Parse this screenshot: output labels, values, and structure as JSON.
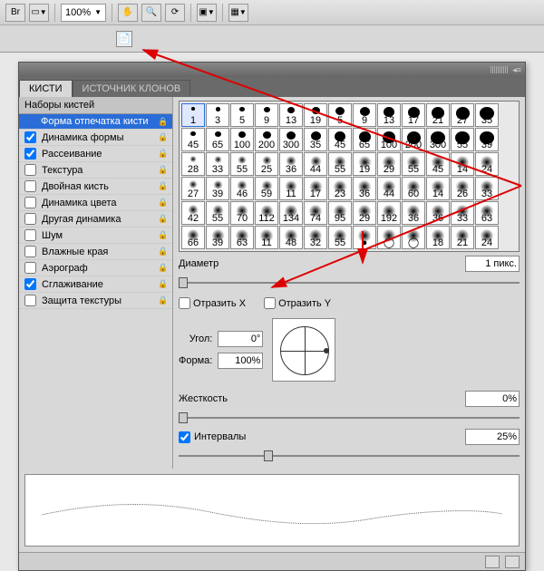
{
  "toolbar": {
    "bridge": "Br",
    "zoom": "100%",
    "icons": [
      "film",
      "hand",
      "zoom",
      "rotate",
      "screen",
      "frame"
    ]
  },
  "panel": {
    "tabs": {
      "brushes": "КИСТИ",
      "clone": "ИСТОЧНИК КЛОНОВ"
    },
    "leftHeader": "Наборы кистей",
    "options": [
      {
        "label": "Форма отпечатка кисти",
        "checked": false,
        "noCheckbox": true,
        "selected": true
      },
      {
        "label": "Динамика формы",
        "checked": true
      },
      {
        "label": "Рассеивание",
        "checked": true
      },
      {
        "label": "Текстура",
        "checked": false
      },
      {
        "label": "Двойная кисть",
        "checked": false
      },
      {
        "label": "Динамика цвета",
        "checked": false
      },
      {
        "label": "Другая динамика",
        "checked": false
      },
      {
        "label": "Шум",
        "checked": false
      },
      {
        "label": "Влажные края",
        "checked": false
      },
      {
        "label": "Аэрограф",
        "checked": false
      },
      {
        "label": "Сглаживание",
        "checked": true
      },
      {
        "label": "Защита текстуры",
        "checked": false
      }
    ],
    "brushSizes": [
      [
        1,
        3,
        5,
        9,
        13,
        19,
        5,
        9,
        13,
        17,
        21,
        27,
        35
      ],
      [
        45,
        65,
        100,
        200,
        300,
        35,
        45,
        65,
        100,
        200,
        300,
        55,
        39
      ],
      [
        28,
        33,
        55,
        25,
        36,
        44,
        55,
        19,
        29,
        55,
        45,
        14,
        24
      ],
      [
        27,
        39,
        46,
        59,
        11,
        17,
        23,
        36,
        44,
        60,
        14,
        26,
        33
      ],
      [
        42,
        55,
        70,
        112,
        134,
        74,
        95,
        29,
        192,
        36,
        36,
        33,
        63
      ],
      [
        66,
        39,
        63,
        11,
        48,
        32,
        55,
        "●",
        "◯",
        "◯",
        18,
        21,
        24
      ]
    ],
    "diameter": {
      "label": "Диаметр",
      "value": "1 пикс."
    },
    "flipX": "Отразить X",
    "flipY": "Отразить Y",
    "angle": {
      "label": "Угол:",
      "value": "0°"
    },
    "shape": {
      "label": "Форма:",
      "value": "100%"
    },
    "hardness": {
      "label": "Жесткость",
      "value": "0%"
    },
    "spacing": {
      "label": "Интервалы",
      "checked": true,
      "value": "25%"
    }
  }
}
